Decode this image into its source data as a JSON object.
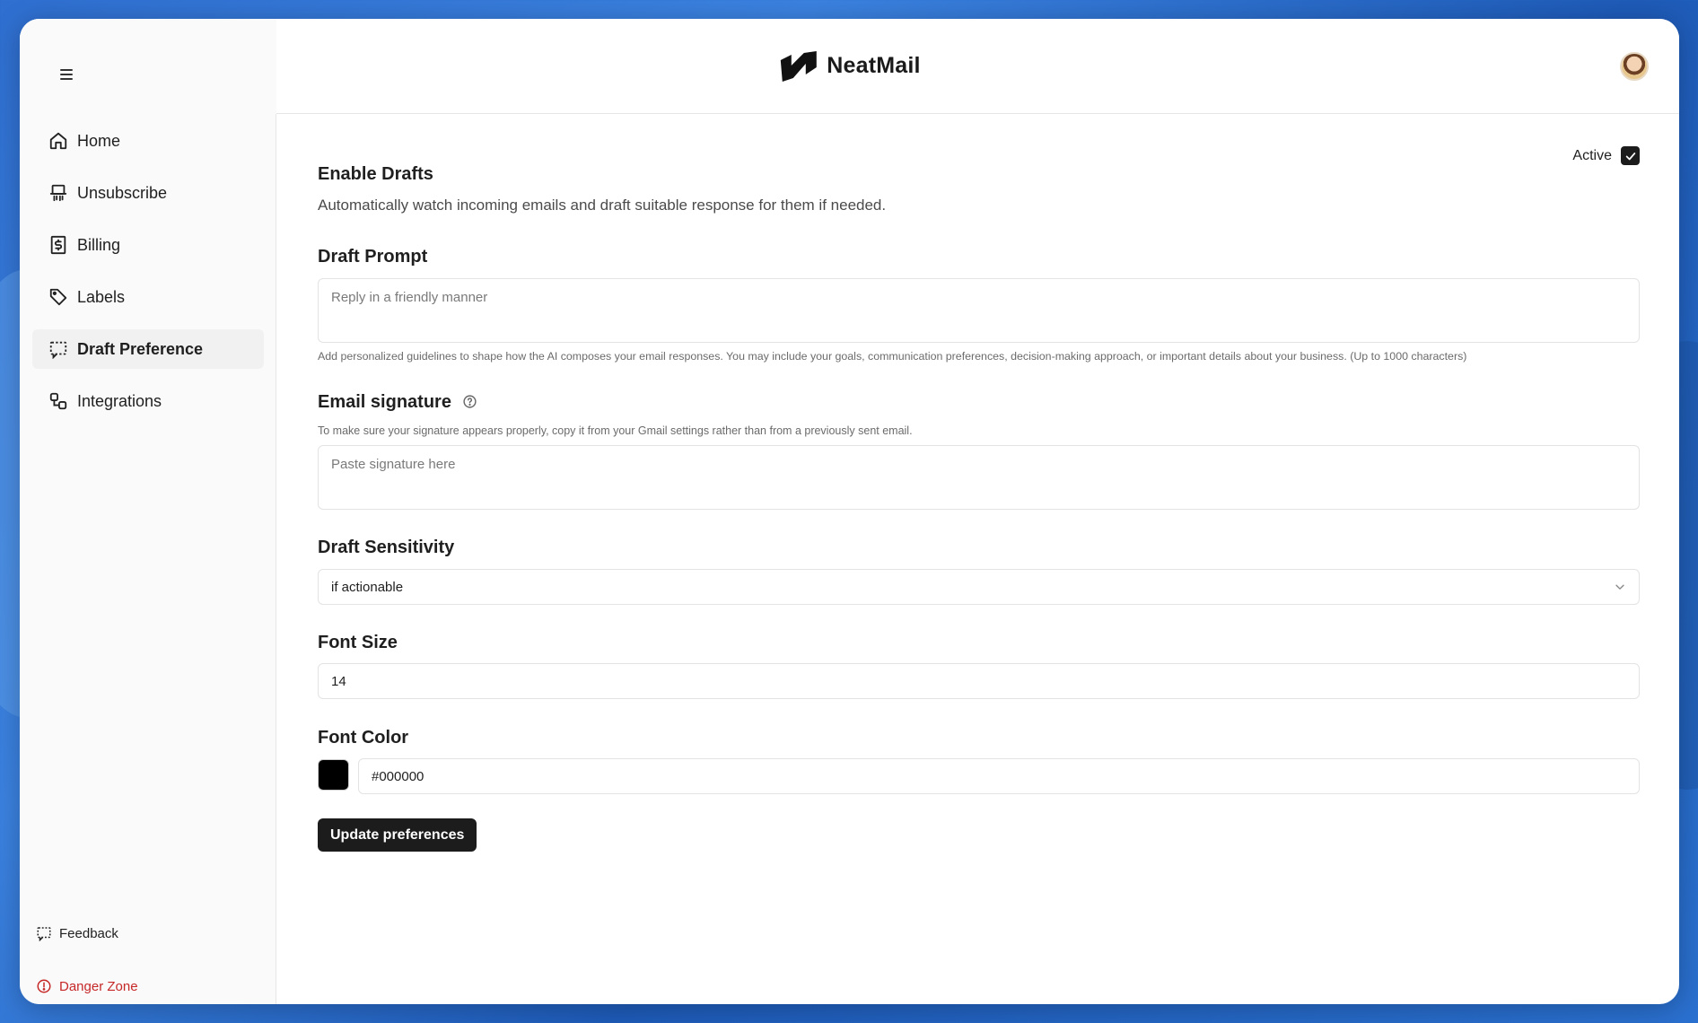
{
  "app": {
    "name": "NeatMail"
  },
  "header": {
    "menu_icon": "hamburger-icon",
    "avatar_icon": "avatar"
  },
  "sidebar": {
    "items": [
      {
        "label": "Home",
        "icon": "home-icon"
      },
      {
        "label": "Unsubscribe",
        "icon": "unsubscribe-icon"
      },
      {
        "label": "Billing",
        "icon": "billing-icon"
      },
      {
        "label": "Labels",
        "icon": "tag-icon"
      },
      {
        "label": "Draft Preference",
        "icon": "draft-icon",
        "active": true
      },
      {
        "label": "Integrations",
        "icon": "integrations-icon"
      }
    ],
    "footer": {
      "feedback": "Feedback",
      "danger_zone": "Danger Zone"
    }
  },
  "main": {
    "enable_drafts": {
      "title": "Enable Drafts",
      "description": "Automatically watch incoming emails and draft suitable response for them if needed.",
      "status_label": "Active",
      "checked": true
    },
    "draft_prompt": {
      "title": "Draft Prompt",
      "placeholder": "Reply in a friendly manner",
      "value": "",
      "helper": "Add personalized guidelines to shape how the AI composes your email responses. You may include your goals, communication preferences, decision-making approach, or important details about your business. (Up to 1000 characters)"
    },
    "email_signature": {
      "title": "Email signature",
      "helper": "To make sure your signature appears properly, copy it from your Gmail settings rather than from a previously sent email.",
      "placeholder": "Paste signature here",
      "value": ""
    },
    "draft_sensitivity": {
      "title": "Draft Sensitivity",
      "selected": "if actionable"
    },
    "font_size": {
      "title": "Font Size",
      "value": "14"
    },
    "font_color": {
      "title": "Font Color",
      "value": "#000000",
      "swatch": "#000000"
    },
    "update_button": "Update preferences"
  },
  "colors": {
    "accent": "#1c1c1c",
    "danger": "#c62828",
    "sidebar_bg": "#fafafa"
  }
}
